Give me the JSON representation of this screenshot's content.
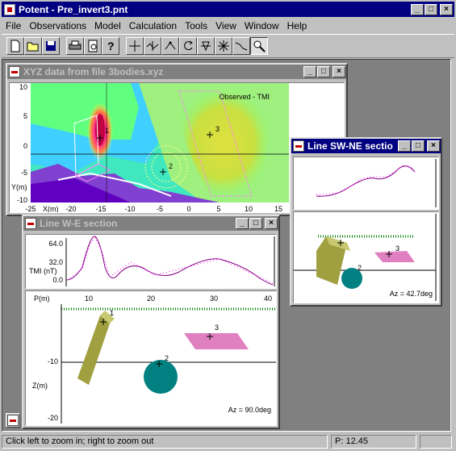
{
  "app": {
    "title": "Potent - Pre_invert3.pnt"
  },
  "menu": [
    "File",
    "Observations",
    "Model",
    "Calculation",
    "Tools",
    "View",
    "Window",
    "Help"
  ],
  "toolbar": {
    "buttons": [
      "new-file",
      "open-folder",
      "save-disk",
      "print",
      "print-preview",
      "help-question",
      "crosshair",
      "profile-line",
      "draw-point",
      "rotate",
      "transform",
      "move-body",
      "line-path",
      "zoom"
    ]
  },
  "windows": {
    "xyz": {
      "title": "XYZ data from file 3bodies.xyz",
      "annotation": "Observed - TMI",
      "y_axis_label": "Y(m)",
      "x_axis_label": "X(m)",
      "y_ticks": [
        "10",
        "5",
        "0",
        "-5",
        "-10"
      ],
      "x_ticks": [
        "-25",
        "-20",
        "-15",
        "-10",
        "-5",
        "0",
        "5",
        "10",
        "15"
      ],
      "body_labels": [
        "1",
        "2",
        "3"
      ]
    },
    "swne": {
      "title": "Line SW-NE section",
      "azimuth": "Az = 42.7deg",
      "body_labels": [
        "1",
        "2",
        "3"
      ]
    },
    "we": {
      "title": "Line W-E section",
      "tmi_label": "TMI (nT)",
      "tmi_ticks": [
        "64.0",
        "32.0",
        "0.0"
      ],
      "p_label": "P(m)",
      "p_ticks": [
        "10",
        "20",
        "30",
        "40"
      ],
      "z_label": "Z(m)",
      "z_ticks": [
        "-10",
        "-20"
      ],
      "azimuth": "Az = 90.0deg",
      "body_labels": [
        "1",
        "2",
        "3"
      ]
    }
  },
  "status": {
    "hint": "Click left to zoom in; right to zoom out",
    "position": "P: 12.45"
  },
  "colors": {
    "title_active": "#000080",
    "title_inactive": "#808080",
    "observed": "#800080",
    "calc": "#ff00ff",
    "section_line": "#008000"
  }
}
